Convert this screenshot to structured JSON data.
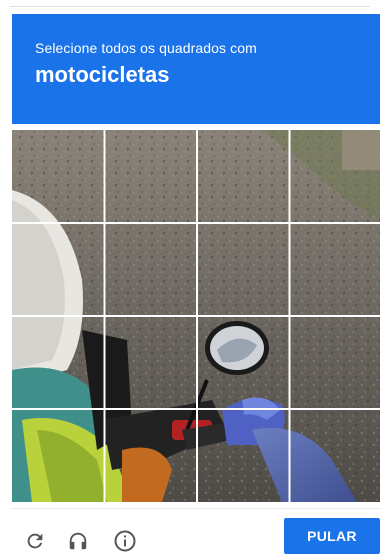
{
  "challenge": {
    "instruction": "Selecione todos os quadrados com",
    "target": "motocicletas",
    "grid_rows": 4,
    "grid_cols": 4
  },
  "footer": {
    "skip_label": "PULAR",
    "icons": [
      "reload-icon",
      "headphones-icon",
      "info-icon"
    ]
  },
  "colors": {
    "accent": "#1a73e8",
    "text_on_accent": "#ffffff",
    "icon": "#555555"
  }
}
